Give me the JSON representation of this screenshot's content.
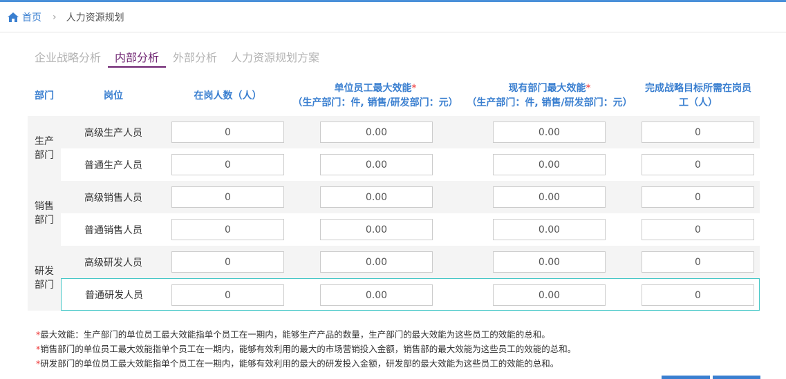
{
  "breadcrumb": {
    "home": "首页",
    "current": "人力资源规划"
  },
  "tabs": [
    "企业战略分析",
    "内部分析",
    "外部分析",
    "人力资源规划方案"
  ],
  "headers": {
    "dept": "部门",
    "position": "岗位",
    "staff": "在岗人数（人）",
    "unit_eff": "单位员工最大效能",
    "unit_eff_sub": "（生产部门：件, 销售/研发部门：元）",
    "dept_eff": "现有部门最大效能",
    "dept_eff_sub": "（生产部门：件, 销售/研发部门：元）",
    "needed_l1": "完成战略目标所需在岗员",
    "needed_l2": "工（人）",
    "required_mark": "*"
  },
  "departments": [
    {
      "name_l1": "生产",
      "name_l2": "部门"
    },
    {
      "name_l1": "销售",
      "name_l2": "部门"
    },
    {
      "name_l1": "研发",
      "name_l2": "部门"
    }
  ],
  "rows": [
    {
      "position": "高级生产人员",
      "staff": "0",
      "unit_eff": "0.00",
      "dept_eff": "0.00",
      "needed": "0"
    },
    {
      "position": "普通生产人员",
      "staff": "0",
      "unit_eff": "0.00",
      "dept_eff": "0.00",
      "needed": "0"
    },
    {
      "position": "高级销售人员",
      "staff": "0",
      "unit_eff": "0.00",
      "dept_eff": "0.00",
      "needed": "0"
    },
    {
      "position": "普通销售人员",
      "staff": "0",
      "unit_eff": "0.00",
      "dept_eff": "0.00",
      "needed": "0"
    },
    {
      "position": "高级研发人员",
      "staff": "0",
      "unit_eff": "0.00",
      "dept_eff": "0.00",
      "needed": "0"
    },
    {
      "position": "普通研发人员",
      "staff": "0",
      "unit_eff": "0.00",
      "dept_eff": "0.00",
      "needed": "0"
    }
  ],
  "notes": [
    "最大效能：生产部门的单位员工最大效能指单个员工在一期内，能够生产产品的数量，生产部门的最大效能为这些员工的效能的总和。",
    "销售部门的单位员工最大效能指单个员工在一期内，能够有效利用的最大的市场营销投入金额，销售部的最大效能为这些员工的效能的总和。",
    "研发部门的单位员工最大效能指单个员工在一期内，能够有效利用的最大的研发投入金额，研发部的最大效能为这些员工的效能的总和。"
  ],
  "note_mark": "*",
  "colors": {
    "accent": "#3a7fd0",
    "active_tab": "#6b1f6e",
    "required": "#ee3333",
    "selected_border": "#45c7c7"
  }
}
